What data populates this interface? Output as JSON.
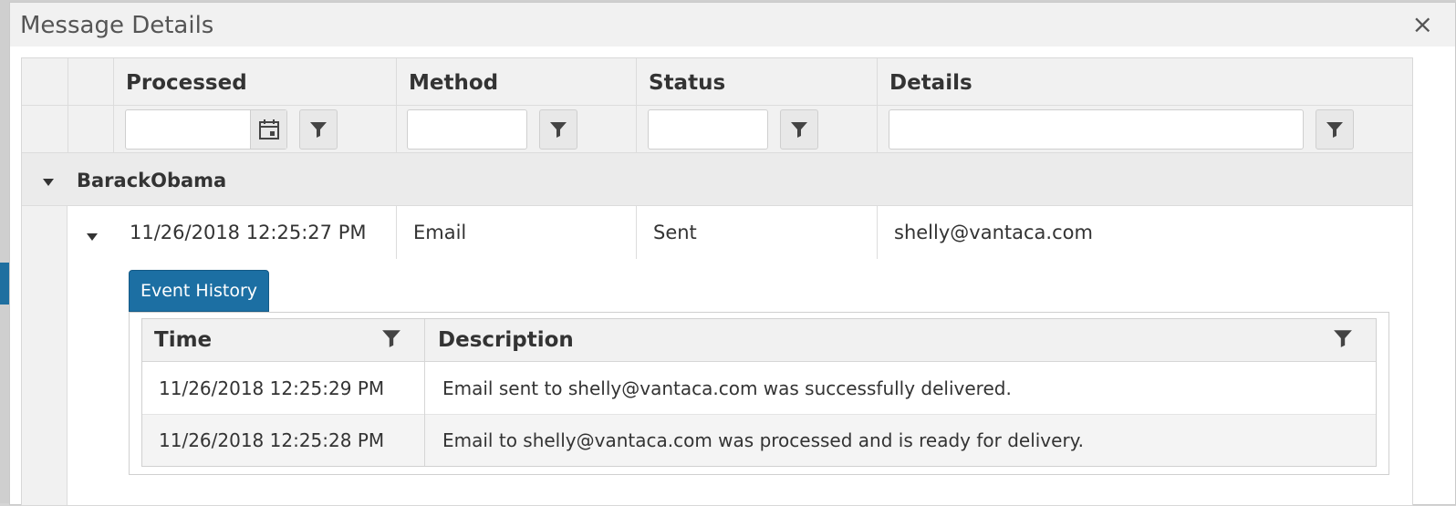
{
  "dialog": {
    "title": "Message Details",
    "close_label": "×"
  },
  "grid": {
    "columns": [
      {
        "label": "Processed"
      },
      {
        "label": "Method"
      },
      {
        "label": "Status"
      },
      {
        "label": "Details"
      }
    ],
    "filters": {
      "processed": {
        "value": "",
        "placeholder": ""
      },
      "method": {
        "value": "",
        "placeholder": ""
      },
      "status": {
        "value": "",
        "placeholder": ""
      },
      "details": {
        "value": "",
        "placeholder": ""
      }
    },
    "group": {
      "label": "BarackObama"
    },
    "rows": [
      {
        "processed": "11/26/2018 12:25:27 PM",
        "method": "Email",
        "status": "Sent",
        "details": "shelly@vantaca.com"
      }
    ]
  },
  "detail": {
    "tab_label": "Event History",
    "columns": [
      {
        "label": "Time"
      },
      {
        "label": "Description"
      }
    ],
    "rows": [
      {
        "time": "11/26/2018 12:25:29 PM",
        "description": "Email sent to shelly@vantaca.com was successfully delivered."
      },
      {
        "time": "11/26/2018 12:25:28 PM",
        "description": "Email to shelly@vantaca.com was processed and is ready for delivery."
      }
    ]
  },
  "icons": {
    "filter": "filter-icon",
    "calendar": "calendar-icon",
    "collapse": "caret-down-icon",
    "close": "close-icon"
  },
  "colors": {
    "accent": "#1c6fa3",
    "header_bg": "#f1f1f1",
    "group_bg": "#ebebeb"
  }
}
